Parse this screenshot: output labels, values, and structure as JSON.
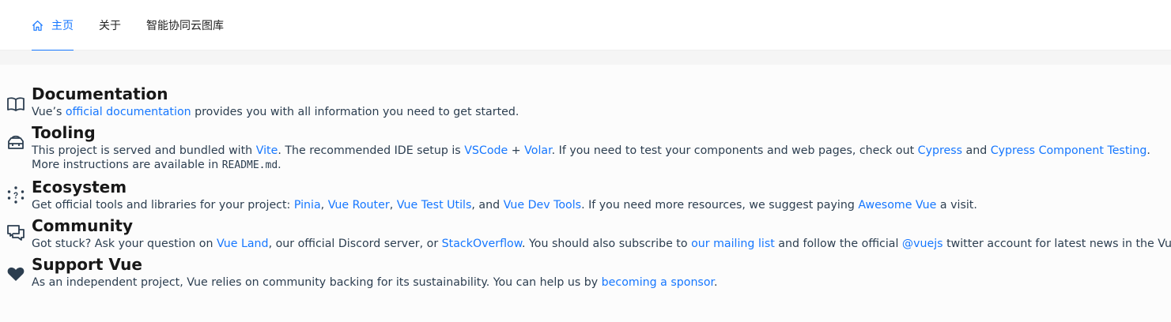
{
  "nav": {
    "items": [
      {
        "label": "主页",
        "icon": "home-icon",
        "active": true
      },
      {
        "label": "关于"
      },
      {
        "label": "智能协同云图库"
      }
    ]
  },
  "colors": {
    "accent": "#1677ff",
    "heading": "#181818",
    "text": "#2c3e50",
    "band": "#f5f5f5"
  },
  "sections": {
    "documentation": {
      "icon": "book-icon",
      "title": "Documentation",
      "text_1": "Vue’s ",
      "link_1": "official documentation",
      "text_2": " provides you with all information you need to get started."
    },
    "tooling": {
      "icon": "toolbox-icon",
      "title": "Tooling",
      "text_1": "This project is served and bundled with ",
      "link_vite": "Vite",
      "text_2": ". The recommended IDE setup is ",
      "link_vscode": "VSCode",
      "text_3": " + ",
      "link_volar": "Volar",
      "text_4": ". If you need to test your components and web pages, check out ",
      "link_cypress": "Cypress",
      "text_5": " and ",
      "link_cypress_ct": "Cypress Component Testing",
      "text_6": ".",
      "line2_text": "More instructions are available in ",
      "line2_code": "README.md",
      "line2_end": "."
    },
    "ecosystem": {
      "icon": "ecosystem-icon",
      "title": "Ecosystem",
      "text_1": "Get official tools and libraries for your project: ",
      "link_pinia": "Pinia",
      "sep_1": ", ",
      "link_router": "Vue Router",
      "sep_2": ", ",
      "link_test_utils": "Vue Test Utils",
      "sep_3": ", and ",
      "link_devtools": "Vue Dev Tools",
      "text_2": ". If you need more resources, we suggest paying ",
      "link_awesome": "Awesome Vue",
      "text_3": " a visit."
    },
    "community": {
      "icon": "chat-icon",
      "title": "Community",
      "text_1": "Got stuck? Ask your question on ",
      "link_vueland": "Vue Land",
      "text_2": ", our official Discord server, or ",
      "link_stackoverflow": "StackOverflow",
      "text_3": ". You should also subscribe to ",
      "link_mailing": "our mailing list",
      "text_4": " and follow the official ",
      "link_vuejs": "@vuejs",
      "text_5": " twitter account for latest news in the Vue world."
    },
    "support": {
      "icon": "heart-icon",
      "title": "Support Vue",
      "text_1": "As an independent project, Vue relies on community backing for its sustainability. You can help us by ",
      "link_sponsor": "becoming a sponsor",
      "text_2": "."
    }
  }
}
